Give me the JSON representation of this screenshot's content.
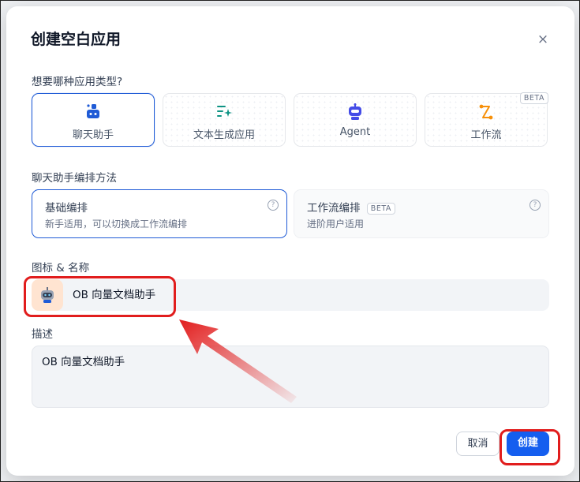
{
  "dialog": {
    "title": "创建空白应用",
    "close_glyph": "×"
  },
  "app_type": {
    "question": "想要哪种应用类型?",
    "options": [
      {
        "label": "聊天助手",
        "icon": "chat-bot-icon",
        "selected": true
      },
      {
        "label": "文本生成应用",
        "icon": "text-generation-icon",
        "selected": false
      },
      {
        "label": "Agent",
        "icon": "agent-robot-icon",
        "selected": false
      },
      {
        "label": "工作流",
        "icon": "workflow-icon",
        "selected": false,
        "badge": "BETA"
      }
    ]
  },
  "orchestration": {
    "label": "聊天助手编排方法",
    "options": [
      {
        "name": "基础编排",
        "description": "新手适用，可以切换成工作流编排",
        "selected": true
      },
      {
        "name": "工作流编排",
        "badge": "BETA",
        "description": "进阶用户适用",
        "selected": false
      }
    ],
    "help_glyph": "?"
  },
  "icon_name": {
    "label": "图标 & 名称",
    "avatar_icon": "robot-avatar-icon",
    "value": "OB 向量文档助手"
  },
  "description": {
    "label": "描述",
    "value": "OB 向量文档助手"
  },
  "footer": {
    "cancel_label": "取消",
    "create_label": "创建"
  },
  "colors": {
    "primary": "#155eef",
    "selected_border": "#1f5bd6",
    "annotation_red": "#e11d1d",
    "chat_icon": "#1f5bd6",
    "text_gen_icon": "#0e9384",
    "agent_icon": "#444ce7",
    "workflow_icon": "#f79009",
    "avatar_bg": "#ffe4d1"
  }
}
